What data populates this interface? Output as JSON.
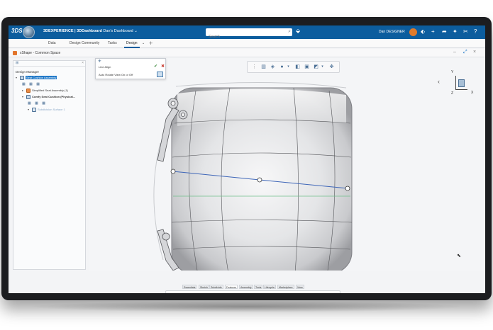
{
  "topbar": {
    "app_title_bold": "3DEXPERIENCE | 3DDashboard",
    "dashboard_name": "Dan's Dashboard",
    "search_placeholder": "Search",
    "username": "Dan DESIGNER",
    "accent_color": "#0c5d9e"
  },
  "tabs": [
    {
      "label": "Data"
    },
    {
      "label": "Design Community"
    },
    {
      "label": "Tasks"
    },
    {
      "label": "Design"
    }
  ],
  "app": {
    "name": "xShape - Common Space"
  },
  "design_manager": {
    "title": "Design Manager",
    "tree": [
      {
        "label": "Seat Cushion Assembly"
      },
      {
        "label": "Simplified Seat Assembly (1)"
      },
      {
        "label": "Comfy Seat Cushion (Physical..."
      },
      {
        "label": "Subdivision Surface 1"
      }
    ]
  },
  "command_panel": {
    "row1": "Line Align",
    "row2": "Auto Rotate View On or Off"
  },
  "triad": {
    "y": "Y",
    "x": "X",
    "z": "Z"
  },
  "bottom_tabs": [
    {
      "label": "Essentials"
    },
    {
      "label": "Sketch"
    },
    {
      "label": "Subdivide"
    },
    {
      "label": "Features"
    },
    {
      "label": "Assembly"
    },
    {
      "label": "Tools"
    },
    {
      "label": "Lifecycle"
    },
    {
      "label": "Marketplace"
    },
    {
      "label": "View"
    }
  ]
}
